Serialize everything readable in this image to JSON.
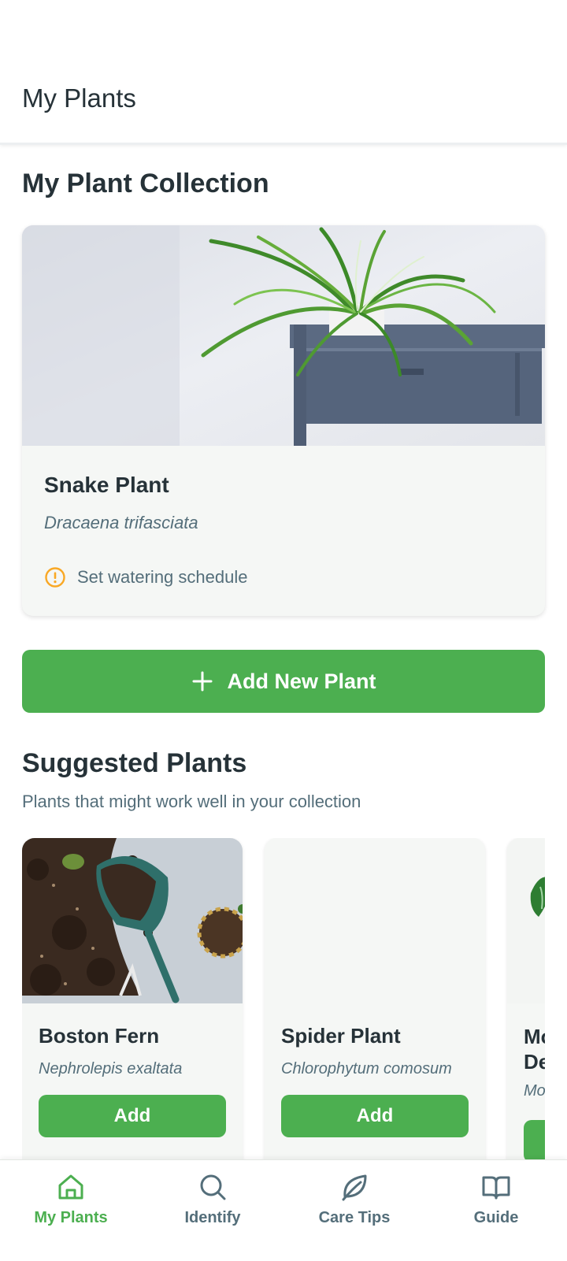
{
  "header": {
    "title": "My Plants"
  },
  "collection": {
    "title": "My Plant Collection",
    "card": {
      "name": "Snake Plant",
      "scientific_name": "Dracaena trifasciata",
      "alert_icon": "alert-circle-icon",
      "alert_text": "Set watering schedule"
    },
    "add_button": {
      "icon": "plus-icon",
      "label": "Add New Plant"
    }
  },
  "suggested": {
    "title": "Suggested Plants",
    "subtitle": "Plants that might work well in your collection",
    "cards": [
      {
        "name": "Boston Fern",
        "scientific_name": "Nephrolepis exaltata",
        "button": "Add"
      },
      {
        "name": "Spider Plant",
        "scientific_name": "Chlorophytum comosum",
        "button": "Add"
      },
      {
        "name": "Mo\nDe",
        "scientific_name": "Mo",
        "button": ""
      }
    ]
  },
  "bottom_nav": {
    "active_color": "#4caf50",
    "inactive_color": "#546e7a",
    "items": [
      {
        "label": "My Plants",
        "icon": "home-icon",
        "active": true
      },
      {
        "label": "Identify",
        "icon": "search-icon",
        "active": false
      },
      {
        "label": "Care Tips",
        "icon": "leaf-icon",
        "active": false
      },
      {
        "label": "Guide",
        "icon": "book-icon",
        "active": false
      }
    ]
  },
  "colors": {
    "primary": "#4caf50",
    "warning": "#f9a825",
    "text": "#263238",
    "muted": "#546e7a"
  }
}
